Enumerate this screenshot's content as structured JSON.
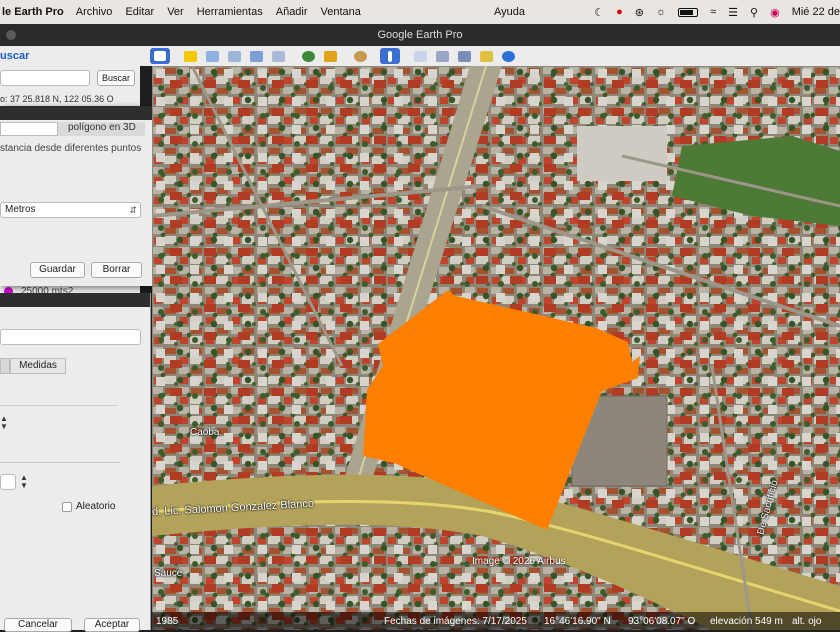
{
  "menubar": {
    "app_name": "le Earth Pro",
    "items": [
      "Archivo",
      "Editar",
      "Ver",
      "Herramientas",
      "Añadir",
      "Ventana",
      "Ayuda"
    ],
    "clock": "Mié 22 de"
  },
  "window": {
    "title": "Google Earth Pro"
  },
  "sidebar": {
    "search_tab": "uscar",
    "search_placeholder": "",
    "search_button": "Buscar",
    "coords": "o: 37 25.818 N, 122 05.36 O",
    "polygon_item": "25000 mts2"
  },
  "measure_dialog": {
    "tab_polygon": "polígono en 3D",
    "description": "stancia desde diferentes puntos",
    "units_value": "Metros",
    "save_button": "Guardar",
    "clear_button": "Borrar"
  },
  "properties_dialog": {
    "tab_measures": "Medidas",
    "random_checkbox": "Aleatorio",
    "cancel_button": "Cancelar",
    "accept_button": "Aceptar"
  },
  "map": {
    "labels": [
      {
        "text": "Caoba"
      },
      {
        "text": "d. Lic. Salomon Gonzalez Blanco"
      },
      {
        "text": "Sauce"
      },
      {
        "text": "De Sacrificio"
      }
    ],
    "attribution": "Image © 2026 Airbus",
    "overlay_color": "#ff7f00"
  },
  "statusbar": {
    "year": "1985",
    "imagery_date": "Fechas de imágenes: 7/17/2025",
    "lat": "16°46'16.90\" N",
    "lon": "93°06'08.07\" O",
    "elevation": "elevación  549 m",
    "eye_alt": "alt. ojo"
  }
}
